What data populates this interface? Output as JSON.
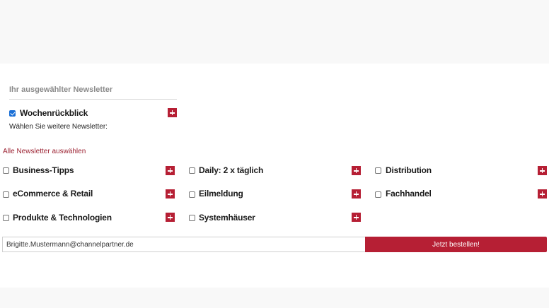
{
  "selected": {
    "heading": "Ihr ausgewählter Newsletter",
    "newsletter": {
      "label": "Wochenrückblick",
      "checked": true
    }
  },
  "more_text": "Wählen Sie weitere Newsletter:",
  "select_all_link": "Alle Newsletter auswählen",
  "newsletters": [
    {
      "label": "Business-Tipps",
      "checked": false
    },
    {
      "label": "Daily: 2 x täglich",
      "checked": false
    },
    {
      "label": "Distribution",
      "checked": false
    },
    {
      "label": "eCommerce & Retail",
      "checked": false
    },
    {
      "label": "Eilmeldung",
      "checked": false
    },
    {
      "label": "Fachhandel",
      "checked": false
    },
    {
      "label": "Produkte & Technologien",
      "checked": false
    },
    {
      "label": "Systemhäuser",
      "checked": false
    }
  ],
  "form": {
    "email_value": "Brigitte.Mustermann@channelpartner.de",
    "submit_label": "Jetzt bestellen!"
  },
  "colors": {
    "accent": "#b61f34",
    "link": "#9b2030",
    "checkbox_checked": "#1a6fd6"
  },
  "icons": {
    "expand": "plus-icon"
  }
}
